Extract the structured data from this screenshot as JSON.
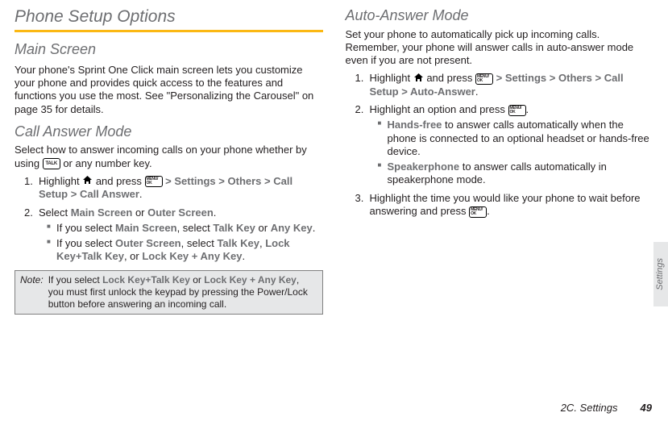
{
  "left": {
    "h_setup": "Phone Setup Options",
    "h_main": "Main Screen",
    "main_p": "Your phone's Sprint One Click main screen lets you customize your phone and provides quick access to the features and functions you use the most. See \"Personalizing the Carousel\" on page 35 for details.",
    "h_call": "Call Answer Mode",
    "call_p": "Select how to answer incoming calls on your phone whether by using ",
    "call_p_tail": " or any number key.",
    "step1_a": "Highlight ",
    "step1_b": " and press ",
    "step1_settings": "Settings",
    "step1_others": "Others",
    "step1_callsetup": "Call Setup",
    "step1_callanswer": "Call Answer",
    "step2_a": "Select ",
    "step2_main": "Main Screen",
    "step2_or": " or ",
    "step2_outer": "Outer Screen",
    "sub1_a": "If you select ",
    "sub1_main": "Main Screen",
    "sub1_b": ", select ",
    "sub1_talk": "Talk Key",
    "sub1_or": " or ",
    "sub1_any": "Any Key",
    "sub2_a": "If you select ",
    "sub2_outer": "Outer Screen",
    "sub2_b": ", select ",
    "sub2_talk": "Talk Key",
    "sub2_lkt": "Lock Key+Talk Key",
    "sub2_or": ", or ",
    "sub2_lka": "Lock Key + Any Key",
    "note_label": "Note:",
    "note_a": "If you select ",
    "note_lkt": "Lock Key+Talk Key",
    "note_or": " or ",
    "note_lka": "Lock Key + Any Key",
    "note_b": ", you must first unlock the keypad by pressing the Power/Lock button before answering an incoming call."
  },
  "right": {
    "h_auto": "Auto-Answer Mode",
    "auto_p": "Set your phone to automatically pick up incoming calls. Remember, your phone will answer calls in auto-answer mode even if you are not present.",
    "step1_a": "Highlight ",
    "step1_b": " and press ",
    "step1_settings": "Settings",
    "step1_others": "Others",
    "step1_callsetup": "Call Setup",
    "step1_auto": "Auto-Answer",
    "step2_a": "Highlight an option and press ",
    "sub1_hf": "Hands-free",
    "sub1_b": " to answer calls automatically when the phone is connected to an optional headset or hands-free device.",
    "sub2_sp": "Speakerphone",
    "sub2_b": " to answer calls automatically in speakerphone mode.",
    "step3_a": "Highlight the time you would like your phone to wait before answering and press "
  },
  "icons": {
    "talk": "TALK",
    "menu_ok": "MENU/\nOK",
    "home": "home-icon"
  },
  "footer": {
    "path": "2C. Settings",
    "page": "49"
  },
  "side_tab": "Settings"
}
